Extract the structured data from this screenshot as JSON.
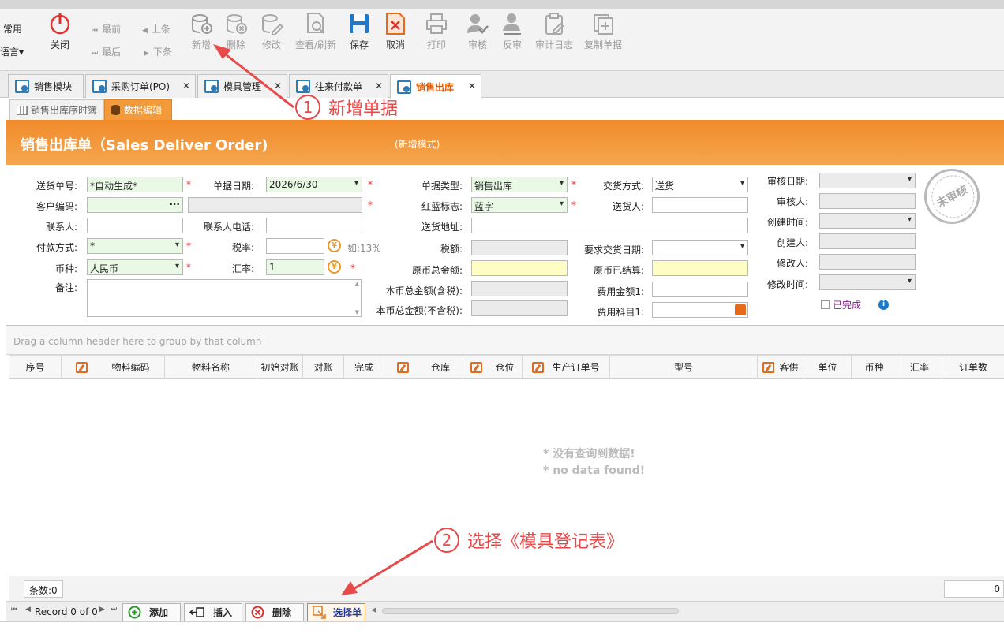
{
  "toolbar": {
    "common_label": "常用",
    "language_label": "语言▾",
    "close_label": "关闭",
    "nav_first": "最前",
    "nav_prev": "上条",
    "nav_last": "最后",
    "nav_next": "下条",
    "new_label": "新增",
    "delete_label": "删除",
    "edit_label": "修改",
    "view_label": "查看/刷新",
    "save_label": "保存",
    "cancel_label": "取消",
    "print_label": "打印",
    "audit_label": "审核",
    "unaudit_label": "反审",
    "auditlog_label": "审计日志",
    "copy_label": "复制单据"
  },
  "tabs": [
    {
      "label": "销售模块"
    },
    {
      "label": "采购订单(PO)"
    },
    {
      "label": "模具管理"
    },
    {
      "label": "往来付款单"
    },
    {
      "label": "销售出库"
    }
  ],
  "tab_close": "✕",
  "subtabs": [
    {
      "label": "销售出库序时簿"
    },
    {
      "label": "数据编辑"
    }
  ],
  "banner": {
    "title": "销售出库单（Sales Deliver Order)",
    "mode": "(新增模式)"
  },
  "form": {
    "l_no": "送货单号:",
    "v_no": "*自动生成*",
    "l_date": "单据日期:",
    "v_date": "2026/6/30",
    "l_type": "单据类型:",
    "v_type": "销售出库",
    "l_delivery": "交货方式:",
    "v_delivery": "送货",
    "l_cust": "客户编码:",
    "v_cust_btn": "···",
    "l_redblue": "红蓝标志:",
    "v_redblue": "蓝字",
    "l_sender": "送货人:",
    "l_contact": "联系人:",
    "l_phone": "联系人电话:",
    "l_addr": "送货地址:",
    "l_pay": "付款方式:",
    "v_pay": "*",
    "l_taxrate": "税率:",
    "taxrate_hint": "如:13%",
    "l_tax": "税额:",
    "l_reqdate": "要求交货日期:",
    "l_currency": "币种:",
    "v_currency": "人民币",
    "l_exrate": "汇率:",
    "v_exrate": "1",
    "l_orig_total": "原币总金额:",
    "l_orig_settled": "原币已结算:",
    "l_note": "备注:",
    "l_local_total_tax": "本币总金额(含税):",
    "l_fee1": "费用金额1:",
    "l_local_total_notax": "本币总金额(不含税):",
    "l_feeitem1": "费用科目1:",
    "l_auditdate": "审核日期:",
    "l_auditor": "审核人:",
    "l_createtime": "创建时间:",
    "l_creator": "创建人:",
    "l_modifier": "修改人:",
    "l_modtime": "修改时间:",
    "l_done": "已完成",
    "stamp": "未审核",
    "req_mark": "*",
    "yen": "¥"
  },
  "grid": {
    "group_hint": "Drag a column header here to group by that column",
    "columns": [
      "序号",
      "物料编码",
      "物料名称",
      "初始对账",
      "对账",
      "完成",
      "仓库",
      "仓位",
      "生产订单号",
      "型号",
      "客供",
      "单位",
      "币种",
      "汇率",
      "订单数"
    ],
    "nodata1": "* 没有查询到数据!",
    "nodata2": "* no data found!",
    "count": "条数:0",
    "right_value": "0"
  },
  "navbar": {
    "record": "Record 0 of 0",
    "add": "添加",
    "insert": "插入",
    "delete": "删除",
    "select": "选择单"
  },
  "annotations": {
    "a1_num": "1",
    "a1_text": "新增单据",
    "a2_num": "2",
    "a2_text": "选择《模具登记表》"
  },
  "colors": {
    "accent": "#f18b2a",
    "annotation": "#e84a4a",
    "tab_active_text": "#e05a00"
  }
}
